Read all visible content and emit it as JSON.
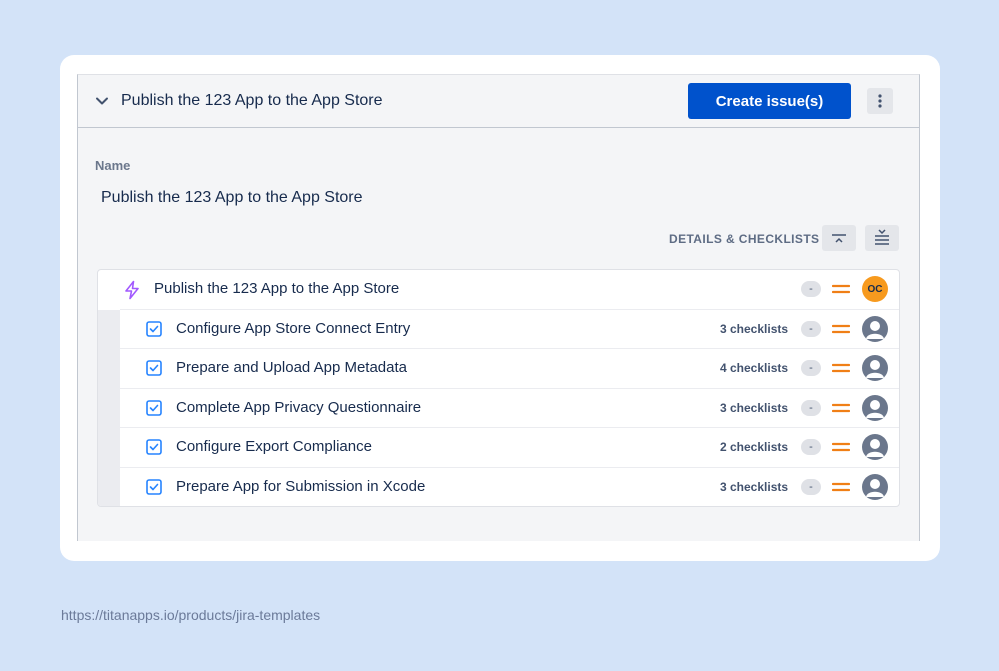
{
  "header": {
    "title": "Publish the 123 App to the App Store",
    "create_button": "Create issue(s)"
  },
  "form": {
    "name_label": "Name",
    "name_value": "Publish the 123 App to the App Store"
  },
  "toolbar": {
    "details_label": "DETAILS & CHECKLISTS"
  },
  "tree": {
    "epic": {
      "title": "Publish the 123 App to the App Store",
      "estimate": "-",
      "assignee_initials": "OC"
    },
    "tasks": [
      {
        "title": "Configure App Store Connect Entry",
        "checklists": "3 checklists",
        "estimate": "-"
      },
      {
        "title": "Prepare and Upload App Metadata",
        "checklists": "4 checklists",
        "estimate": "-"
      },
      {
        "title": "Complete App Privacy Questionnaire",
        "checklists": "3 checklists",
        "estimate": "-"
      },
      {
        "title": "Configure Export Compliance",
        "checklists": "2 checklists",
        "estimate": "-"
      },
      {
        "title": "Prepare App for Submission in Xcode",
        "checklists": "3 checklists",
        "estimate": "-"
      }
    ]
  },
  "footer": {
    "url": "https://titanapps.io/products/jira-templates"
  },
  "colors": {
    "background": "#d3e3f8",
    "primary_button": "#0052cc",
    "epic_icon": "#a259ff",
    "task_icon": "#2684ff",
    "priority_medium": "#f07f16",
    "avatar_initials_bg": "#f79a1e"
  },
  "icons": {
    "collapse": "chevron-down-icon",
    "more": "more-vertical-icon",
    "collapse_all": "collapse-all-icon",
    "expand_all": "expand-all-icon",
    "epic": "lightning-icon",
    "task": "checkbox-icon",
    "priority": "priority-medium-icon",
    "unassigned": "user-avatar-icon"
  }
}
